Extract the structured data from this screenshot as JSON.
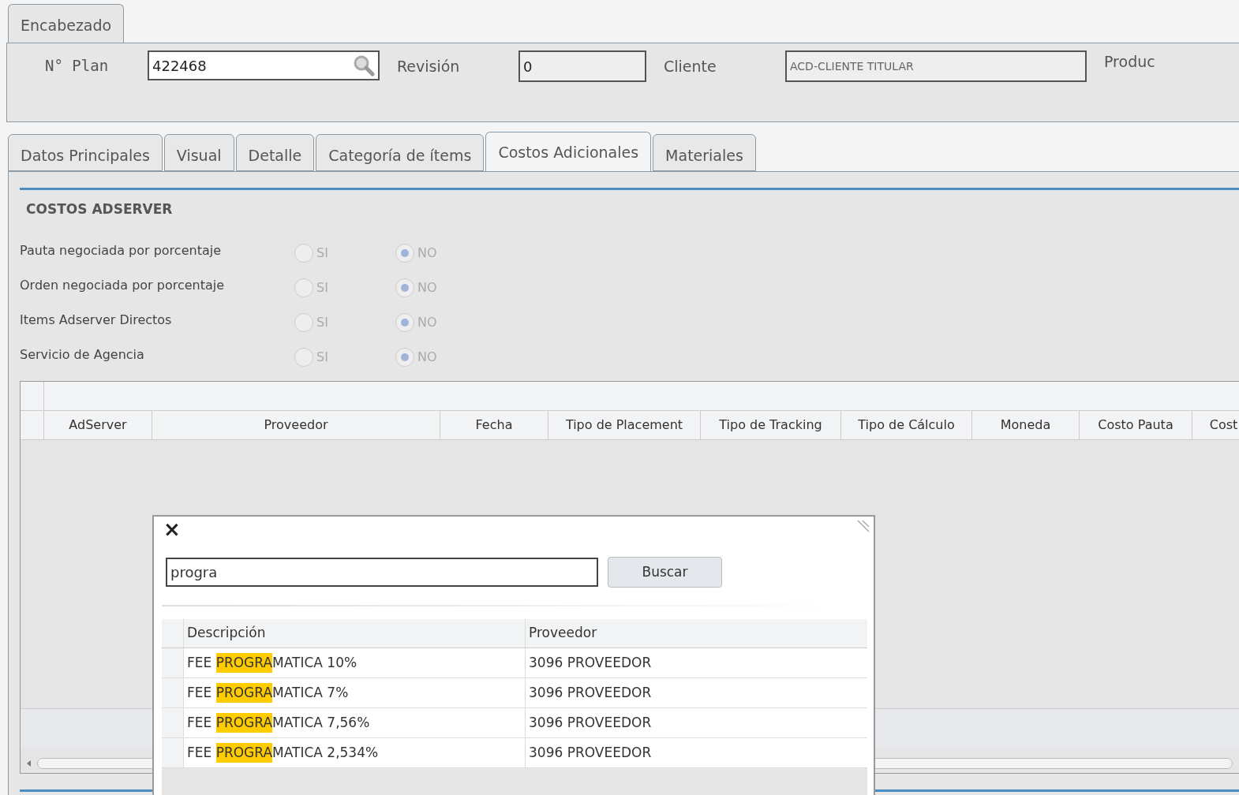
{
  "header_tab": {
    "label": "Encabezado",
    "selected": true
  },
  "header_fields": [
    {
      "kind": "search",
      "label": "N° Plan",
      "value": "422468"
    },
    {
      "kind": "text",
      "label": "Revisión",
      "value": "0"
    },
    {
      "kind": "wide_text",
      "label": "Cliente",
      "value": "ACD-CLIENTE TITULAR"
    },
    {
      "kind": "label",
      "label": "Produc"
    }
  ],
  "tabs": [
    {
      "label": "Datos Principales",
      "selected": false
    },
    {
      "label": "Visual",
      "selected": false
    },
    {
      "label": "Detalle",
      "selected": false
    },
    {
      "label": "Categoría de ítems",
      "selected": false
    },
    {
      "label": "Costos Adicionales",
      "selected": true
    },
    {
      "label": "Materiales",
      "selected": false
    }
  ],
  "section_title": "COSTOS ADSERVER",
  "options": [
    {
      "label": "Pauta negociada por porcentaje",
      "choices": [
        {
          "label": "SI",
          "selected": false
        },
        {
          "label": "NO",
          "selected": true
        }
      ]
    },
    {
      "label": "Orden negociada por porcentaje",
      "choices": [
        {
          "label": "SI",
          "selected": false
        },
        {
          "label": "NO",
          "selected": true
        }
      ]
    },
    {
      "label": "Items Adserver Directos",
      "choices": [
        {
          "label": "SI",
          "selected": false
        },
        {
          "label": "NO",
          "selected": true
        }
      ]
    },
    {
      "label": "Servicio de Agencia",
      "choices": [
        {
          "label": "SI",
          "selected": false
        },
        {
          "label": "NO",
          "selected": true
        }
      ]
    }
  ],
  "table": {
    "columns": [
      "AdServer",
      "Proveedor",
      "Fecha",
      "Tipo de Placement",
      "Tipo de Tracking",
      "Tipo de Cálculo",
      "Moneda",
      "Costo Pauta",
      "Cost"
    ]
  },
  "dialog": {
    "close": "×",
    "search": {
      "value": "progra"
    },
    "button": "Buscar",
    "columns": [
      "Descripción",
      "Proveedor"
    ],
    "rows": [
      {
        "description": {
          "before": "FEE ",
          "match": "PROGRA",
          "after": "MATICA 10%"
        },
        "provider": "3096 PROVEEDOR"
      },
      {
        "description": {
          "before": "FEE ",
          "match": "PROGRA",
          "after": "MATICA 7%"
        },
        "provider": "3096 PROVEEDOR"
      },
      {
        "description": {
          "before": "FEE ",
          "match": "PROGRA",
          "after": "MATICA 7,56%"
        },
        "provider": "3096 PROVEEDOR"
      },
      {
        "description": {
          "before": "FEE ",
          "match": "PROGRA",
          "after": "MATICA 2,534%"
        },
        "provider": "3096 PROVEEDOR"
      }
    ]
  }
}
